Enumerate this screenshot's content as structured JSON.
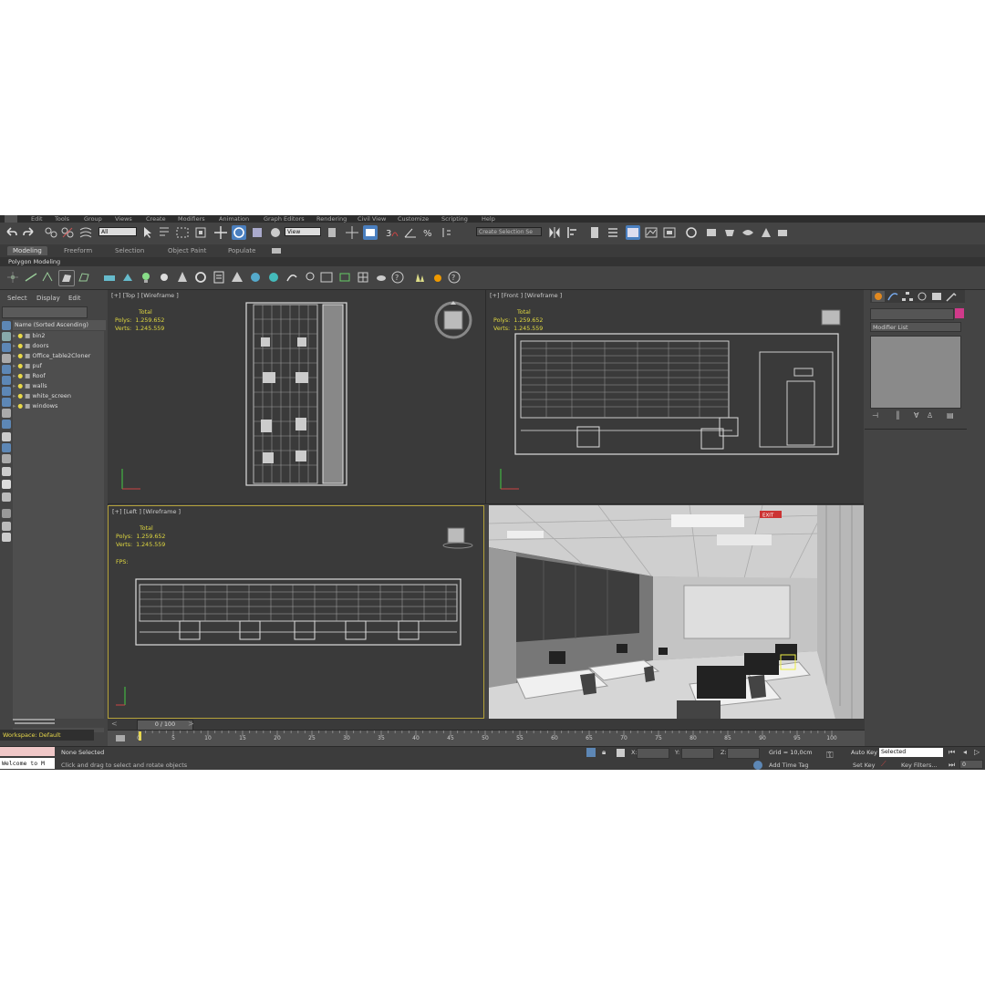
{
  "menu": [
    "Edit",
    "Tools",
    "Group",
    "Views",
    "Create",
    "Modifiers",
    "Animation",
    "Graph Editors",
    "Rendering",
    "Civil View",
    "Customize",
    "Scripting",
    "Help"
  ],
  "toolbar": {
    "filter_value": "All",
    "view_value": "View",
    "selection_set": "Create Selection Se"
  },
  "ribbon": {
    "tabs": [
      "Modeling",
      "Freeform",
      "Selection",
      "Object Paint",
      "Populate"
    ],
    "sub_label": "Polygon Modeling"
  },
  "scene_explorer": {
    "menu": [
      "Select",
      "Display",
      "Edit"
    ],
    "header": "Name (Sorted Ascending)",
    "items": [
      "bin2",
      "doors",
      "Office_table2Cloner",
      "puf",
      "Roof",
      "walls",
      "white_screen",
      "windows"
    ]
  },
  "viewports": {
    "top": {
      "label": "[+] [Top ] [Wireframe ]",
      "stats_total": "Total",
      "polys_label": "Polys:",
      "polys": "1.259.652",
      "verts_label": "Verts:",
      "verts": "1.245.559"
    },
    "front": {
      "label": "[+] [Front ] [Wireframe ]",
      "stats_total": "Total",
      "polys_label": "Polys:",
      "polys": "1.259.652",
      "verts_label": "Verts:",
      "verts": "1.245.559"
    },
    "left": {
      "label": "[+] [Left ] [Wireframe ]",
      "stats_total": "Total",
      "polys_label": "Polys:",
      "polys": "1.259.652",
      "verts_label": "Verts:",
      "verts": "1.245.559",
      "fps_label": "FPS:"
    },
    "persp": {
      "exit_sign": "EXIT"
    }
  },
  "command_panel": {
    "modifier_list": "Modifier List"
  },
  "timeline": {
    "frame_counter": "0 / 100",
    "ticks": [
      "0",
      "5",
      "10",
      "15",
      "20",
      "25",
      "30",
      "35",
      "40",
      "45",
      "50",
      "55",
      "60",
      "65",
      "70",
      "75",
      "80",
      "85",
      "90",
      "95",
      "100"
    ]
  },
  "status": {
    "workspace": "Workspace: Default",
    "maxscript": "Welcome to M",
    "selection": "None Selected",
    "prompt": "Click and drag to select and rotate objects",
    "x_label": "X:",
    "y_label": "Y:",
    "z_label": "Z:",
    "grid": "Grid = 10,0cm",
    "add_time_tag": "Add Time Tag",
    "auto_key": "Auto Key",
    "selected": "Selected",
    "set_key": "Set Key",
    "key_filters": "Key Filters...",
    "frame": "0"
  },
  "colors": {
    "accent": "#5d87b5",
    "stats": "#e0d840",
    "viewport_active": "#b5a23a"
  }
}
